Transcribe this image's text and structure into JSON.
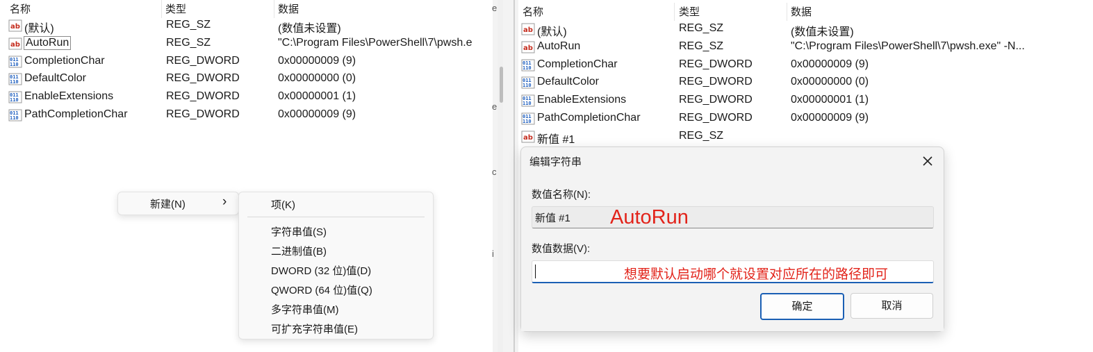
{
  "columns": {
    "name": "名称",
    "type": "类型",
    "data": "数据"
  },
  "left_rows": [
    {
      "icon": "string-value-icon",
      "name": "(默认)",
      "type": "REG_SZ",
      "data": "(数值未设置)"
    },
    {
      "icon": "string-value-icon",
      "name": "AutoRun",
      "type": "REG_SZ",
      "data": "\"C:\\Program Files\\PowerShell\\7\\pwsh.e"
    },
    {
      "icon": "dword-value-icon",
      "name": "CompletionChar",
      "type": "REG_DWORD",
      "data": "0x00000009 (9)"
    },
    {
      "icon": "dword-value-icon",
      "name": "DefaultColor",
      "type": "REG_DWORD",
      "data": "0x00000000 (0)"
    },
    {
      "icon": "dword-value-icon",
      "name": "EnableExtensions",
      "type": "REG_DWORD",
      "data": "0x00000001 (1)"
    },
    {
      "icon": "dword-value-icon",
      "name": "PathCompletionChar",
      "type": "REG_DWORD",
      "data": "0x00000009 (9)"
    }
  ],
  "right_rows": [
    {
      "icon": "string-value-icon",
      "name": "(默认)",
      "type": "REG_SZ",
      "data": "(数值未设置)"
    },
    {
      "icon": "string-value-icon",
      "name": "AutoRun",
      "type": "REG_SZ",
      "data": "\"C:\\Program Files\\PowerShell\\7\\pwsh.exe\" -N..."
    },
    {
      "icon": "dword-value-icon",
      "name": "CompletionChar",
      "type": "REG_DWORD",
      "data": "0x00000009 (9)"
    },
    {
      "icon": "dword-value-icon",
      "name": "DefaultColor",
      "type": "REG_DWORD",
      "data": "0x00000000 (0)"
    },
    {
      "icon": "dword-value-icon",
      "name": "EnableExtensions",
      "type": "REG_DWORD",
      "data": "0x00000001 (1)"
    },
    {
      "icon": "dword-value-icon",
      "name": "PathCompletionChar",
      "type": "REG_DWORD",
      "data": "0x00000009 (9)"
    },
    {
      "icon": "string-value-icon",
      "name": "新值 #1",
      "type": "REG_SZ",
      "data": ""
    }
  ],
  "gap_letters": [
    "e",
    "e",
    "c",
    "i"
  ],
  "context_menu": {
    "parent_label": "新建(N)",
    "submenu_chevron": "›",
    "items": [
      "项(K)",
      "字符串值(S)",
      "二进制值(B)",
      "DWORD (32 位)值(D)",
      "QWORD (64 位)值(Q)",
      "多字符串值(M)",
      "可扩充字符串值(E)"
    ]
  },
  "dialog": {
    "title": "编辑字符串",
    "close_icon": "close-icon",
    "name_label": "数值名称(N):",
    "name_value": "新值 #1",
    "data_label": "数值数据(V):",
    "data_value": "",
    "ok_label": "确定",
    "cancel_label": "取消"
  },
  "annotations": {
    "name_note": "AutoRun",
    "data_note": "想要默认启动哪个就设置对应所在的路径即可",
    "color": "#e2231a"
  },
  "colors": {
    "focus_blue": "#1a5fb4",
    "string_icon_red": "#c42b1c",
    "dword_icon_blue": "#1f5fbf"
  }
}
